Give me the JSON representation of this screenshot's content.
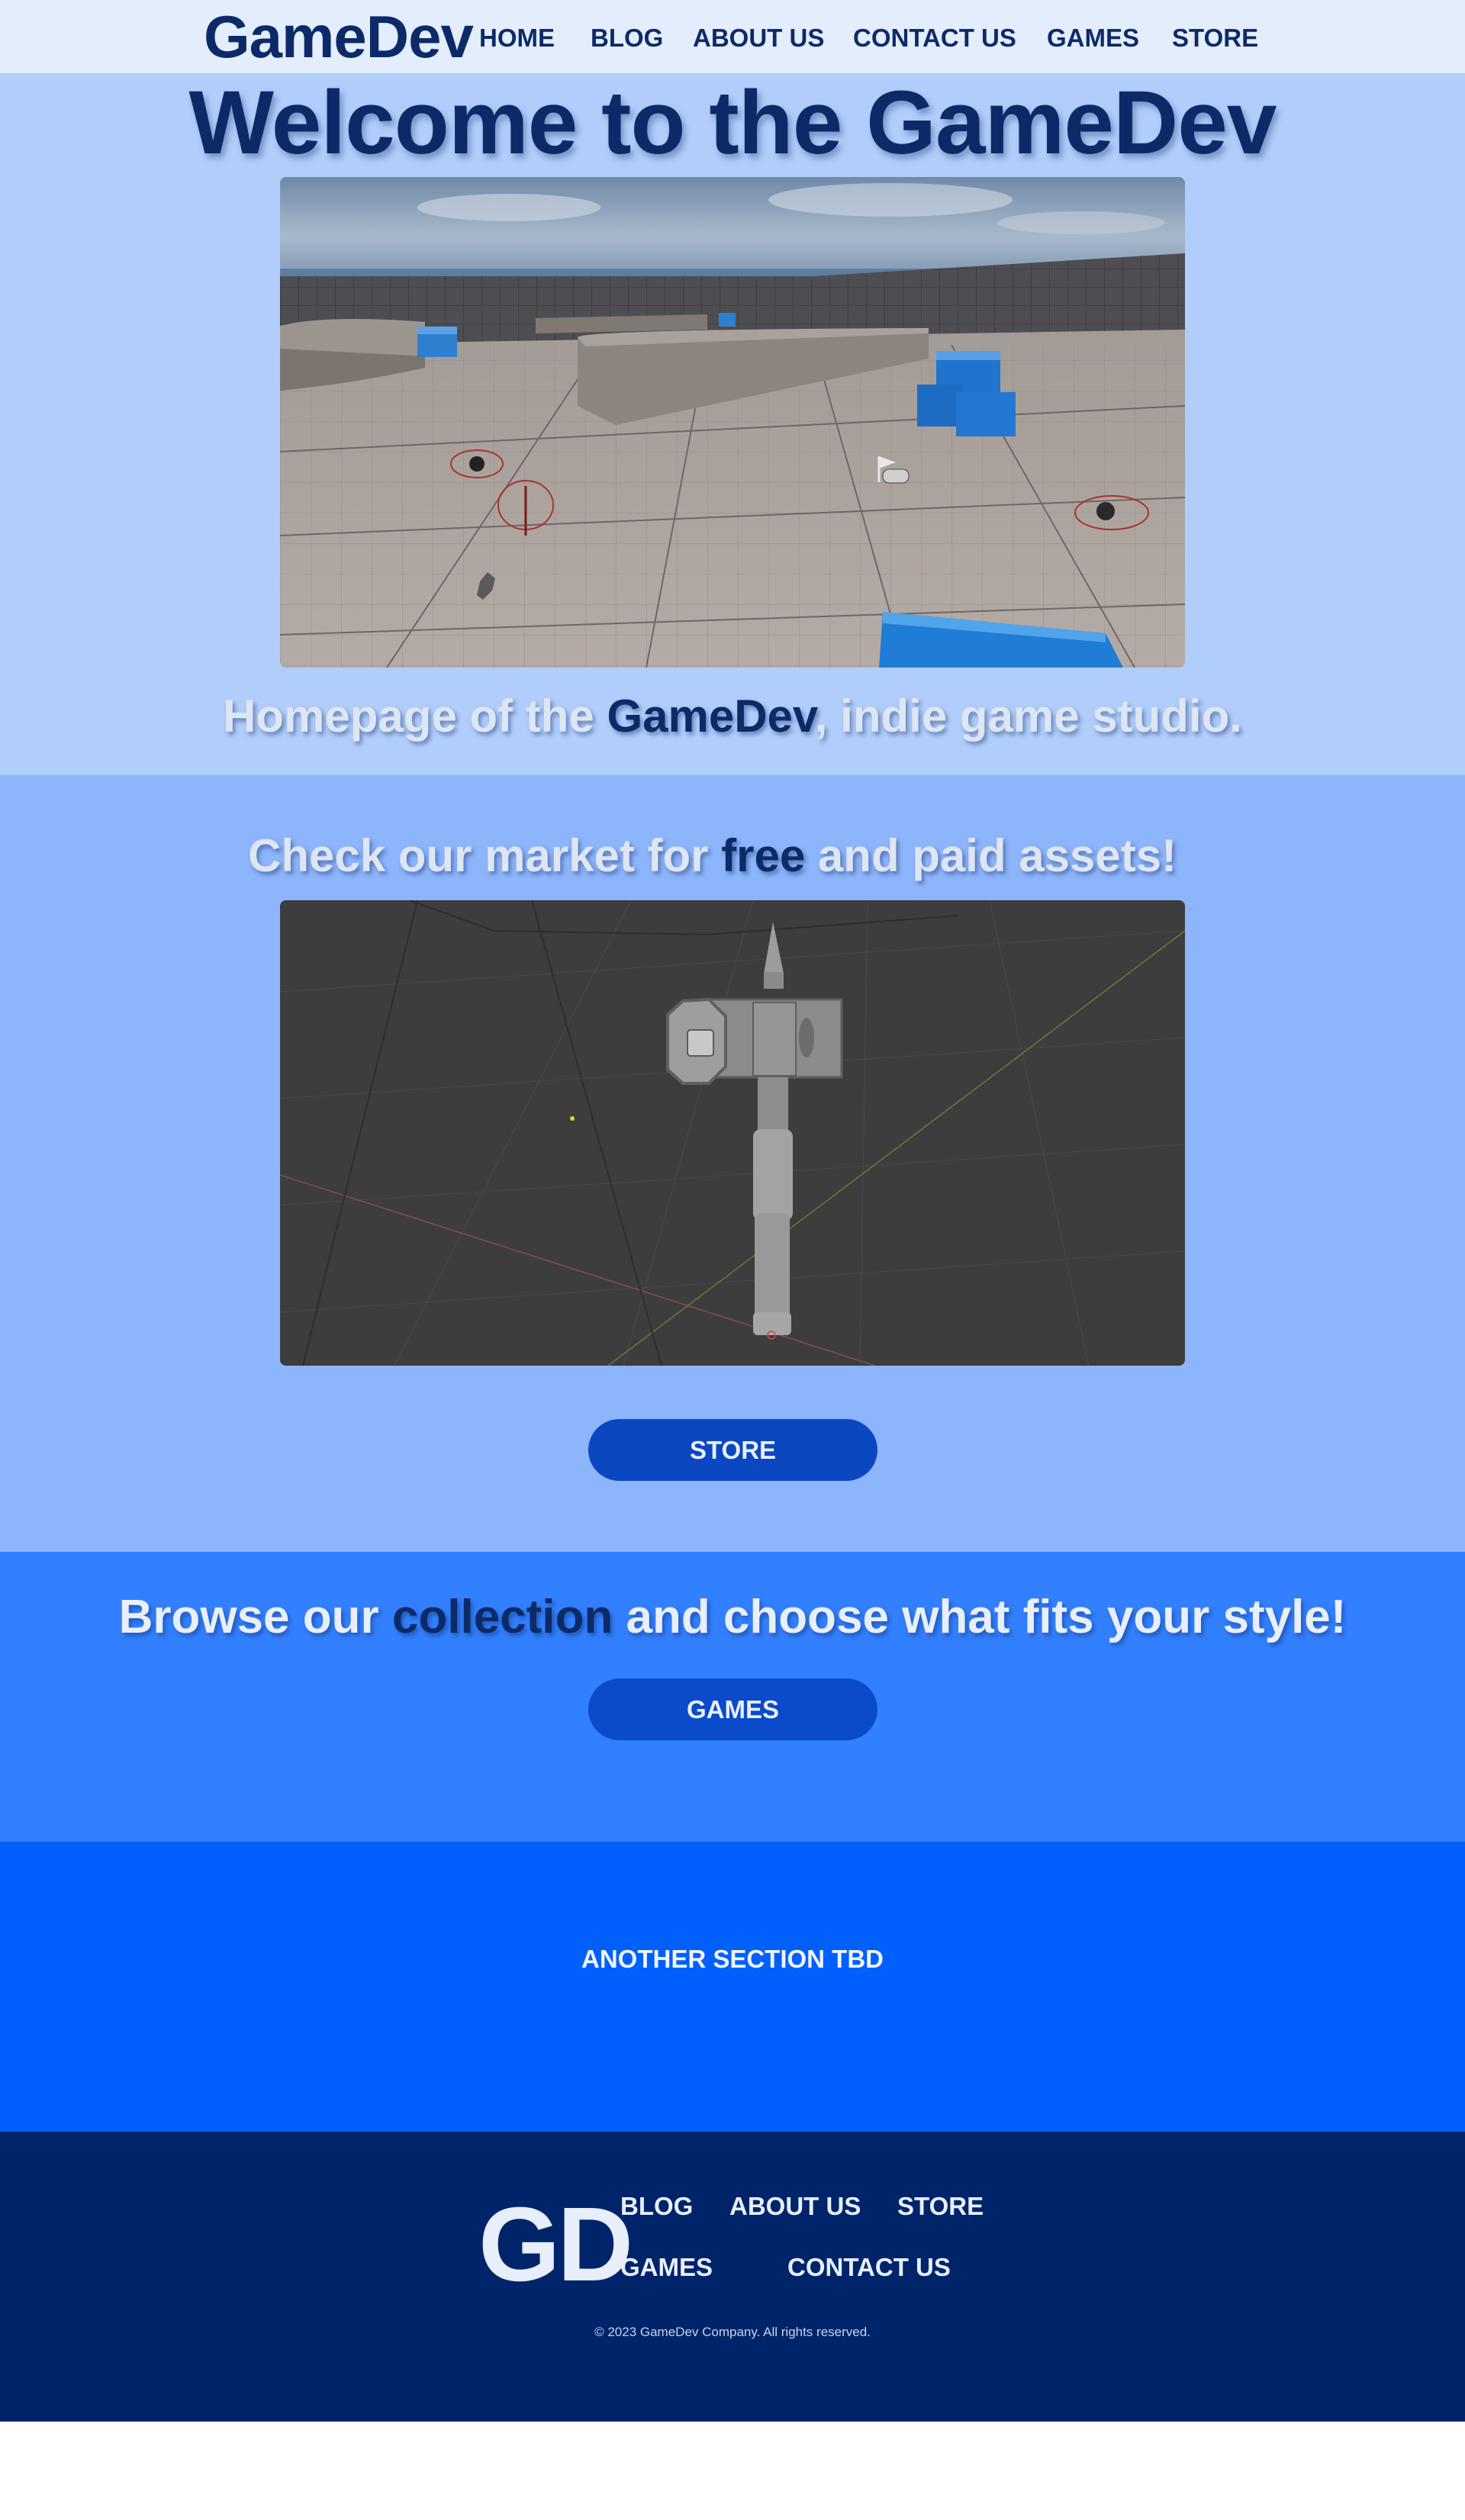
{
  "nav": {
    "logo": "GameDev",
    "items": [
      {
        "label": "HOME"
      },
      {
        "label": "BLOG"
      },
      {
        "label": "ABOUT US"
      },
      {
        "label": "CONTACT US"
      },
      {
        "label": "GAMES"
      },
      {
        "label": "STORE"
      }
    ]
  },
  "hero": {
    "title": "Welcome to the GameDev",
    "subtitle_before": "Homepage of the ",
    "subtitle_accent": "GameDev",
    "subtitle_after": ", indie game studio."
  },
  "market": {
    "title_before": "Check our market for ",
    "title_accent": "free",
    "title_after": " and paid assets!",
    "button_label": "STORE"
  },
  "collection": {
    "title_before": "Browse our ",
    "title_accent": "collection",
    "title_after": " and choose what fits your style!",
    "button_label": "GAMES"
  },
  "tbd": {
    "text": "ANOTHER SECTION TBD"
  },
  "footer": {
    "logo": "GD",
    "links": {
      "blog": "BLOG",
      "about": "ABOUT US",
      "store": "STORE",
      "games": "GAMES",
      "contact": "CONTACT US"
    },
    "copyright": "© 2023 GameDev Company. All rights reserved."
  },
  "colors": {
    "nav_bg": "#e4edfc",
    "hero_bg": "#b0cdfb",
    "market_bg": "#8db5fb",
    "collection_bg": "#3280ff",
    "tbd_bg": "#0160fc",
    "footer_bg": "#00246a",
    "brand_dark": "#0d2a68",
    "button_bg": "#0a47c1"
  }
}
